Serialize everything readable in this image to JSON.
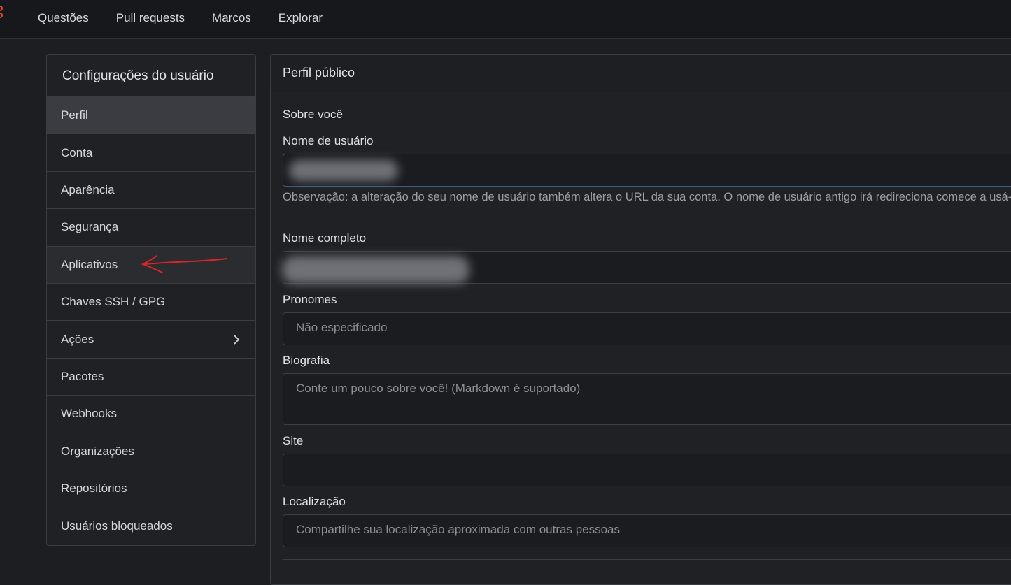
{
  "nav": {
    "items": [
      "Questões",
      "Pull requests",
      "Marcos",
      "Explorar"
    ]
  },
  "sidebar": {
    "title": "Configurações do usuário",
    "items": [
      {
        "label": "Perfil"
      },
      {
        "label": "Conta"
      },
      {
        "label": "Aparência"
      },
      {
        "label": "Segurança"
      },
      {
        "label": "Aplicativos"
      },
      {
        "label": "Chaves SSH / GPG"
      },
      {
        "label": "Ações"
      },
      {
        "label": "Pacotes"
      },
      {
        "label": "Webhooks"
      },
      {
        "label": "Organizações"
      },
      {
        "label": "Repositórios"
      },
      {
        "label": "Usuários bloqueados"
      }
    ]
  },
  "panel": {
    "title": "Perfil público",
    "section": "Sobre você",
    "username_label": "Nome de usuário",
    "username_help": "Observação: a alteração do seu nome de usuário também altera o URL da sua conta. O nome de usuário antigo irá redireciona comece a usá-lo.",
    "fullname_label": "Nome completo",
    "pronouns_label": "Pronomes",
    "pronouns_value": "Não especificado",
    "bio_label": "Biografia",
    "bio_placeholder": "Conte um pouco sobre você! (Markdown é suportado)",
    "site_label": "Site",
    "location_label": "Localização",
    "location_placeholder": "Compartilhe sua localização aproximada com outras pessoas"
  },
  "colors": {
    "accent": "#e8472f",
    "annotation": "#d8262b"
  },
  "icons": {
    "logo": "logo-icon",
    "chevron": "chevron-right-icon"
  }
}
